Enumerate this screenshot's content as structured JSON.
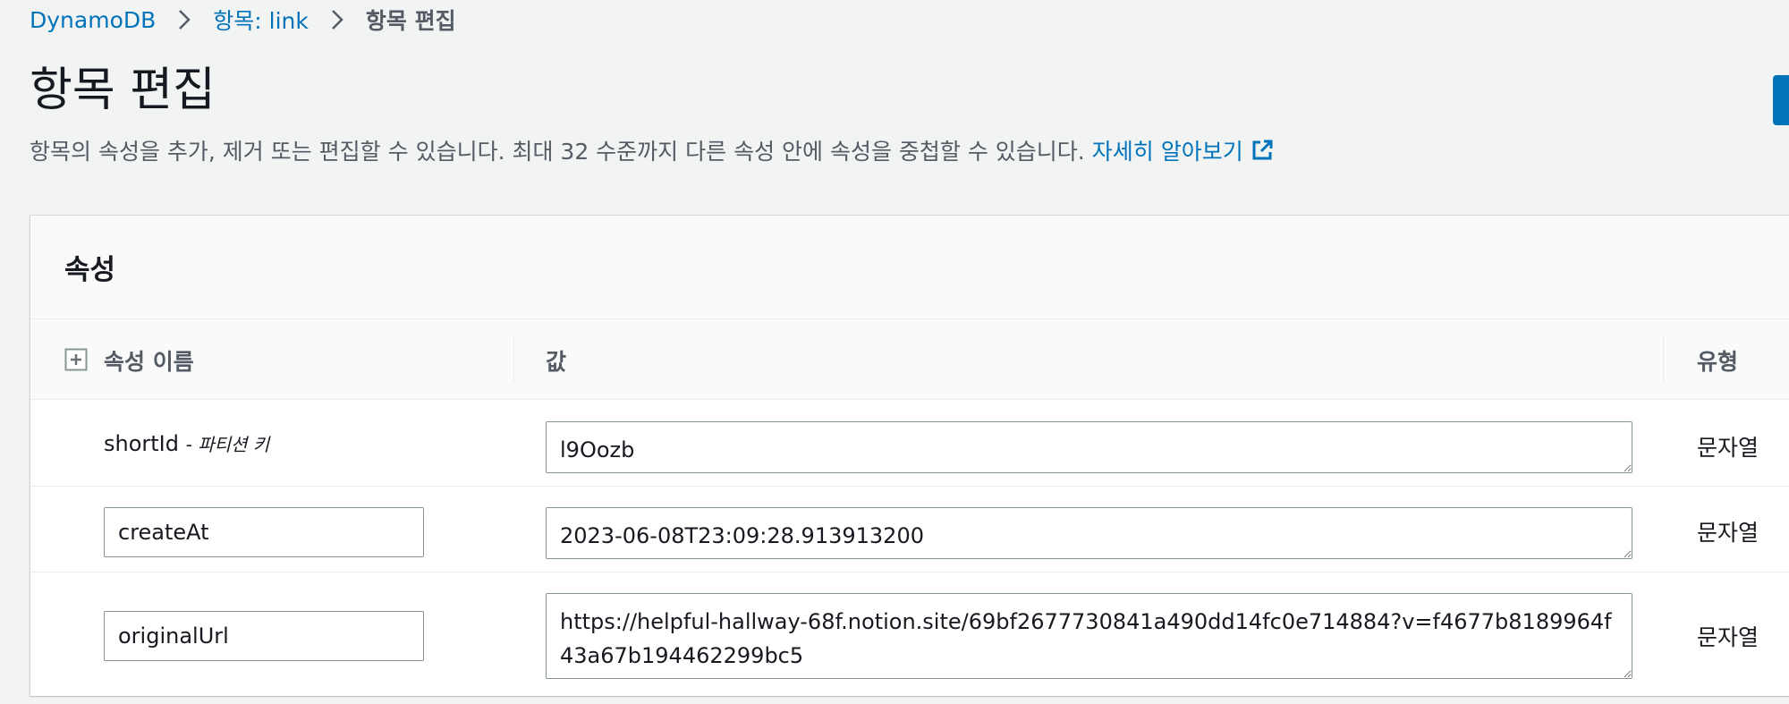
{
  "breadcrumb": {
    "items": [
      "DynamoDB",
      "항목: link"
    ],
    "current": "항목 편집"
  },
  "page": {
    "title": "항목 편집",
    "description": "항목의 속성을 추가, 제거 또는 편집할 수 있습니다. 최대 32 수준까지 다른 속성 안에 속성을 중첩할 수 있습니다.",
    "learn_more": "자세히 알아보기"
  },
  "panel": {
    "title": "속성",
    "columns": {
      "name": "속성 이름",
      "value": "값",
      "type": "유형"
    }
  },
  "attributes": [
    {
      "name": "shortId",
      "key_label": "- 파티션 키",
      "value": "l9Oozb",
      "type": "문자열"
    },
    {
      "name": "createAt",
      "value": "2023-06-08T23:09:28.913913200",
      "type": "문자열"
    },
    {
      "name": "originalUrl",
      "value": "https://helpful-hallway-68f.notion.site/69bf2677730841a490dd14fc0e714884?v=f4677b8189964f43a67b194462299bc5",
      "type": "문자열"
    }
  ],
  "colors": {
    "link": "#0073bb",
    "primary_button": "#0073bb",
    "page_bg": "#f2f3f3"
  },
  "icons": [
    "chevron-right-icon",
    "external-link-icon",
    "add-attribute-icon",
    "resize-handle-icon"
  ]
}
